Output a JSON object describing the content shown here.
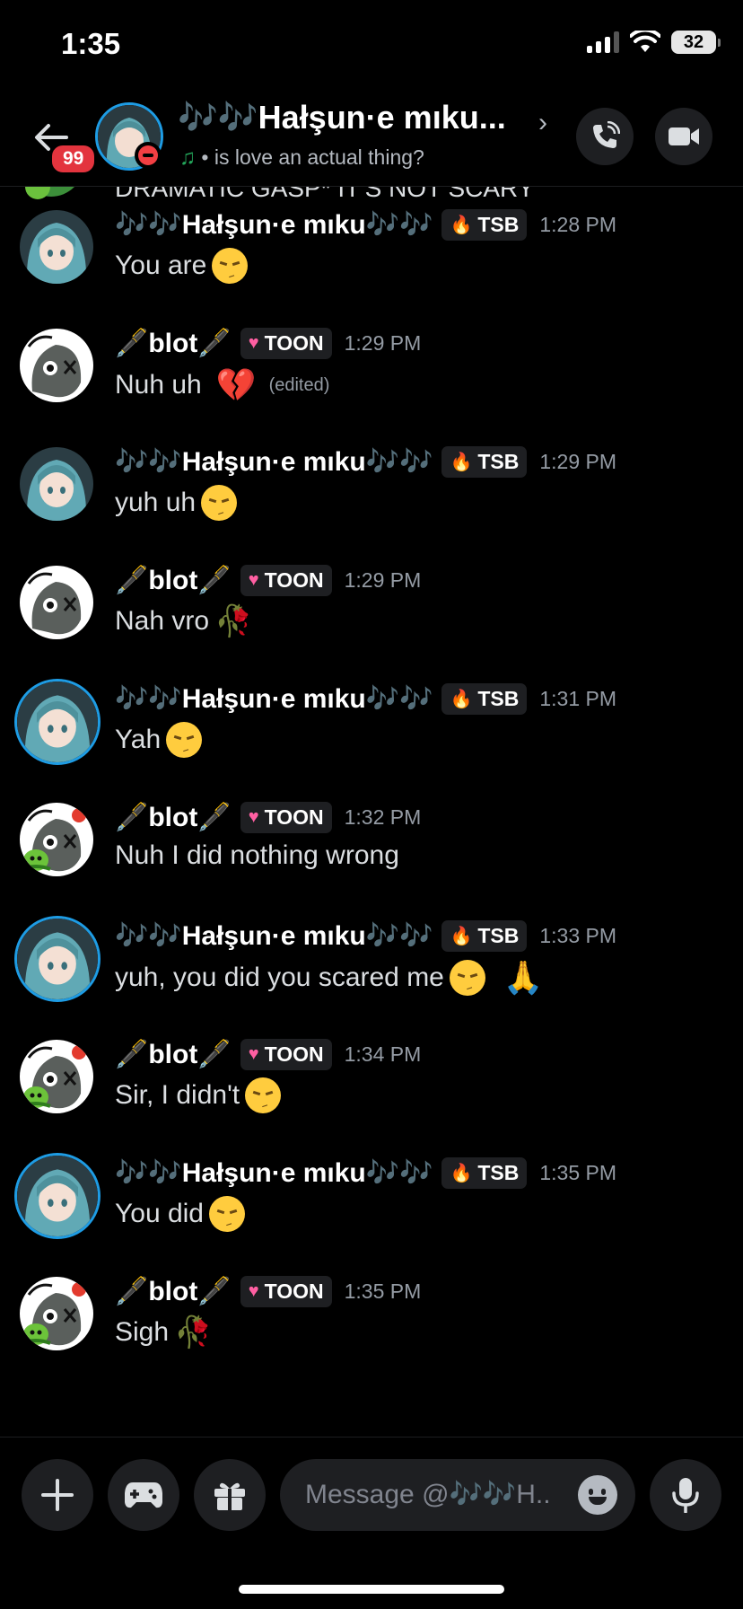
{
  "status_bar": {
    "time": "1:35",
    "battery": "32"
  },
  "header": {
    "unread_count": "99",
    "title": "🎶🎶Hałşun·e mıku...",
    "status_text": "• is love an actual thing?",
    "status_note_icon": "music-note-icon"
  },
  "clipped_text": "DRAMATIC GASP* IT'S NOT SCARY",
  "messages": [
    {
      "user": "🎶🎶Hałşun·e mıku🎶🎶",
      "tag": "TSB",
      "tag_icon": "flame-icon",
      "time": "1:28 PM",
      "text": "You are",
      "emojis": [
        "pensive"
      ],
      "edited": ""
    },
    {
      "user": "🖋️blot🖋️",
      "tag": "TOON",
      "tag_icon": "heart-icon",
      "time": "1:29 PM",
      "text": "Nuh uh",
      "emojis": [
        "broken-heart"
      ],
      "edited": "(edited)"
    },
    {
      "user": "🎶🎶Hałşun·e mıku🎶🎶",
      "tag": "TSB",
      "tag_icon": "flame-icon",
      "time": "1:29 PM",
      "text": "yuh uh",
      "emojis": [
        "pensive"
      ],
      "edited": ""
    },
    {
      "user": "🖋️blot🖋️",
      "tag": "TOON",
      "tag_icon": "heart-icon",
      "time": "1:29 PM",
      "text": "Nah vro",
      "emojis": [
        "wilted-rose"
      ],
      "edited": ""
    },
    {
      "user": "🎶🎶Hałşun·e mıku🎶🎶",
      "tag": "TSB",
      "tag_icon": "flame-icon",
      "time": "1:31 PM",
      "text": "Yah",
      "emojis": [
        "pensive"
      ],
      "edited": ""
    },
    {
      "user": "🖋️blot🖋️",
      "tag": "TOON",
      "tag_icon": "heart-icon",
      "time": "1:32 PM",
      "text": "Nuh I did nothing wrong",
      "emojis": [],
      "edited": ""
    },
    {
      "user": "🎶🎶Hałşun·e mıku🎶🎶",
      "tag": "TSB",
      "tag_icon": "flame-icon",
      "time": "1:33 PM",
      "text": "yuh, you did you scared me",
      "emojis": [
        "pensive",
        "folded-hands"
      ],
      "edited": ""
    },
    {
      "user": "🖋️blot🖋️",
      "tag": "TOON",
      "tag_icon": "heart-icon",
      "time": "1:34 PM",
      "text": "Sir, I didn't",
      "emojis": [
        "pensive"
      ],
      "edited": ""
    },
    {
      "user": "🎶🎶Hałşun·e mıku🎶🎶",
      "tag": "TSB",
      "tag_icon": "flame-icon",
      "time": "1:35 PM",
      "text": "You did",
      "emojis": [
        "pensive"
      ],
      "edited": ""
    },
    {
      "user": "🖋️blot🖋️",
      "tag": "TOON",
      "tag_icon": "heart-icon",
      "time": "1:35 PM",
      "text": "Sigh",
      "emojis": [
        "wilted-rose"
      ],
      "edited": ""
    }
  ],
  "composer": {
    "placeholder": "Message @🎶🎶H..",
    "buttons": [
      "plus-icon",
      "gamepad-icon",
      "gift-icon",
      "emoji-icon",
      "microphone-icon"
    ]
  },
  "colors": {
    "background": "#000000",
    "surface": "#1e1f22",
    "username": "#ffffff",
    "message_text": "#dbdee1",
    "timestamp": "#949ba4",
    "tsb_ring": "#1e9ce4",
    "badge": "#e3343e",
    "dnd": "#f23f43",
    "online_note": "#23a55a"
  }
}
